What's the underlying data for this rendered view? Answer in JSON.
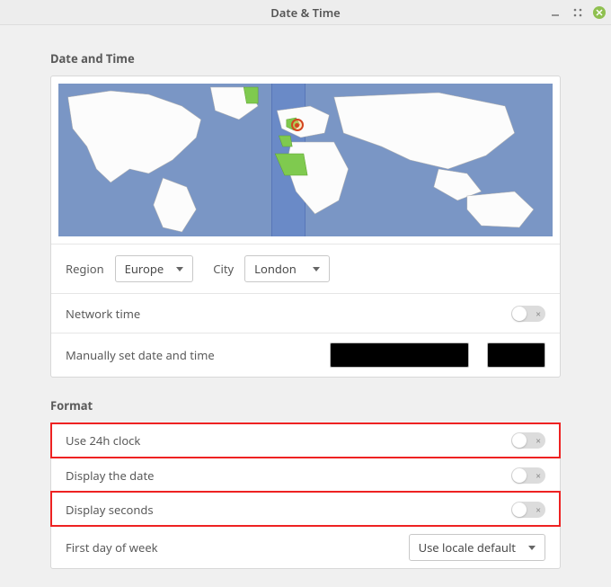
{
  "window": {
    "title": "Date & Time"
  },
  "sections": {
    "datetime": {
      "title": "Date and Time",
      "region_label": "Region",
      "region_value": "Europe",
      "city_label": "City",
      "city_value": "London",
      "network_time_label": "Network time",
      "network_time_on": false,
      "manual_label": "Manually set date and time"
    },
    "format": {
      "title": "Format",
      "use_24h_label": "Use 24h clock",
      "use_24h_on": false,
      "display_date_label": "Display the date",
      "display_date_on": false,
      "display_seconds_label": "Display seconds",
      "display_seconds_on": false,
      "first_day_label": "First day of week",
      "first_day_value": "Use locale default"
    }
  }
}
